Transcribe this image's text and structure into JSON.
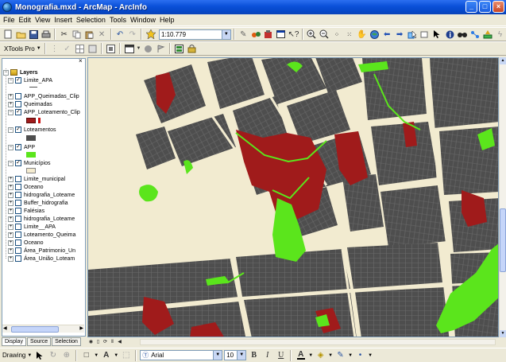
{
  "window": {
    "title": "Monografia.mxd - ArcMap - ArcInfo",
    "controls": {
      "minimize": "_",
      "maximize": "□",
      "close": "×"
    }
  },
  "menubar": {
    "items": [
      "File",
      "Edit",
      "View",
      "Insert",
      "Selection",
      "Tools",
      "Window",
      "Help"
    ]
  },
  "toolbar_main": {
    "scale_value": "1:10.779"
  },
  "toolbar_secondary": {
    "xtools_label": "XTools Pro"
  },
  "toc": {
    "root_label": "Layers",
    "layers": [
      {
        "name": "Limite_APA",
        "checked": true,
        "expanded": true,
        "symbol": "line"
      },
      {
        "name": "APP_Queimadas_Clip",
        "checked": false,
        "expanded": false
      },
      {
        "name": "Queimadas",
        "checked": false,
        "expanded": false
      },
      {
        "name": "APP_Loteamento_Clip",
        "checked": true,
        "expanded": true,
        "symbol": "fill",
        "colors": [
          "#a01b1b",
          "#cc1111"
        ]
      },
      {
        "name": "Loteamentos",
        "checked": true,
        "expanded": true,
        "symbol": "fill",
        "colors": [
          "#4e4e4e"
        ]
      },
      {
        "name": "APP",
        "checked": true,
        "expanded": true,
        "symbol": "fill",
        "colors": [
          "#5be51c"
        ]
      },
      {
        "name": "Municípios",
        "checked": true,
        "expanded": true,
        "symbol": "fill",
        "colors": [
          "#f5ecd0"
        ]
      },
      {
        "name": "Limite_municipal",
        "checked": false,
        "expanded": false
      },
      {
        "name": "Oceano",
        "checked": false,
        "expanded": false
      },
      {
        "name": "hidrografia_Loteame",
        "checked": false,
        "expanded": false
      },
      {
        "name": "Buffer_hidrografia",
        "checked": false,
        "expanded": false
      },
      {
        "name": "Falésias",
        "checked": false,
        "expanded": false
      },
      {
        "name": "hidrografia_Loteame",
        "checked": false,
        "expanded": false
      },
      {
        "name": "Limite__APA",
        "checked": false,
        "expanded": false
      },
      {
        "name": "Loteamento_Queima",
        "checked": false,
        "expanded": false
      },
      {
        "name": "Oceano",
        "checked": false,
        "expanded": false
      },
      {
        "name": "Área_Patrimonio_Un",
        "checked": false,
        "expanded": false
      },
      {
        "name": "Área_União_Loteam",
        "checked": false,
        "expanded": false
      }
    ],
    "tabs": [
      "Display",
      "Source",
      "Selection"
    ]
  },
  "drawing_toolbar": {
    "drawing_label": "Drawing",
    "font_value": "Arial",
    "size_value": "10",
    "bold": "B",
    "italic": "I",
    "underline": "U",
    "font_color_glyph": "A"
  },
  "colors": {
    "background": "#f2ebd0",
    "lots": "#4e4e4e",
    "app": "#5be51c",
    "app_lot_clip": "#a01b1b"
  }
}
